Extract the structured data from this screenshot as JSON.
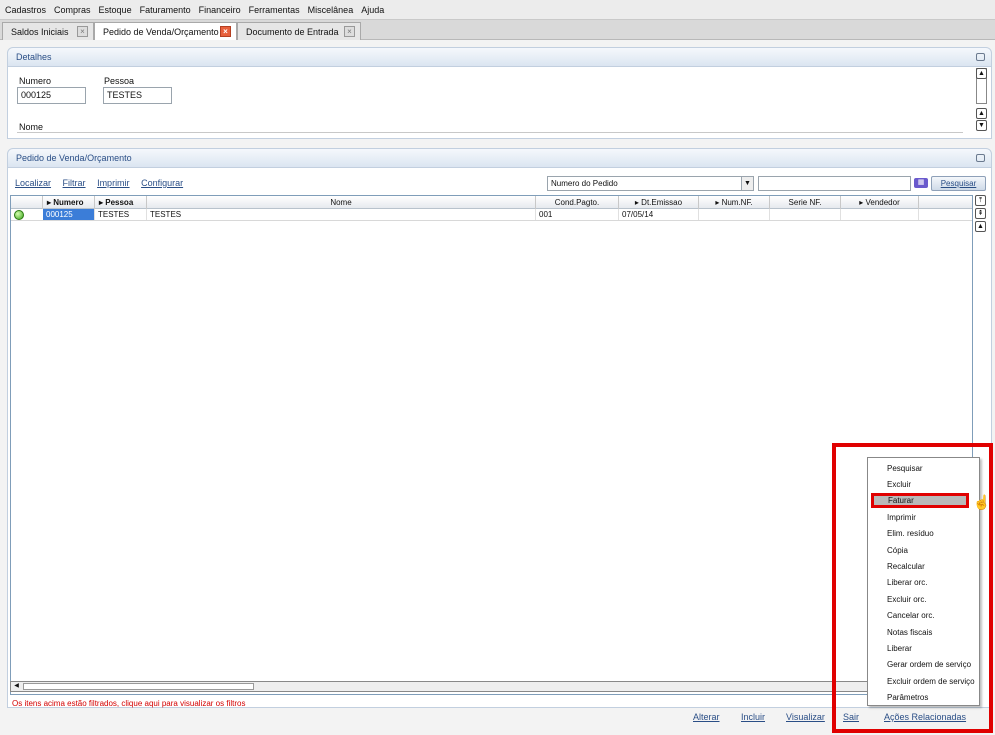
{
  "menu": [
    "Cadastros",
    "Compras",
    "Estoque",
    "Faturamento",
    "Financeiro",
    "Ferramentas",
    "Miscelânea",
    "Ajuda"
  ],
  "tabs": [
    {
      "label": "Saldos Iniciais"
    },
    {
      "label": "Pedido de Venda/Orçamento"
    },
    {
      "label": "Documento de Entrada"
    }
  ],
  "detalhes": {
    "title": "Detalhes",
    "numero_label": "Numero",
    "numero_value": "000125",
    "pessoa_label": "Pessoa",
    "pessoa_value": "TESTES",
    "nome_label": "Nome"
  },
  "pedido": {
    "title": "Pedido de Venda/Orçamento",
    "links": [
      "Localizar",
      "Filtrar",
      "Imprimir",
      "Configurar"
    ],
    "search_field_selected": "Numero do Pedido",
    "search_button": "Pesquisar"
  },
  "table": {
    "headers": [
      "Numero",
      "Pessoa",
      "Nome",
      "Cond.Pagto.",
      "Dt.Emissao",
      "Num.NF.",
      "Serie NF.",
      "Vendedor"
    ],
    "rows": [
      {
        "numero": "000125",
        "pessoa": "TESTES",
        "nome": "TESTES",
        "cond": "001",
        "dt": "07/05/14",
        "numnf": "",
        "serie": "",
        "vendedor": ""
      }
    ]
  },
  "filter_note": "Os itens acima estão filtrados, clique aqui para visualizar os filtros",
  "bottom_actions": [
    "Alterar",
    "Incluir",
    "Visualizar",
    "Sair",
    "Ações Relacionadas"
  ],
  "context_menu": {
    "items": [
      "Pesquisar",
      "Excluir",
      "Faturar",
      "Imprimir",
      "Elim. resíduo",
      "Cópia",
      "Recalcular",
      "Liberar orc.",
      "Excluir orc.",
      "Cancelar orc.",
      "Notas fiscais",
      "Liberar",
      "Gerar ordem de serviço",
      "Excluir ordem de serviço",
      "Parâmetros"
    ],
    "highlighted": "Faturar"
  },
  "colors": {
    "highlight_border": "#e00000",
    "link": "#2a4e86",
    "selected_cell": "#3b7dd8",
    "note": "#d40000"
  }
}
